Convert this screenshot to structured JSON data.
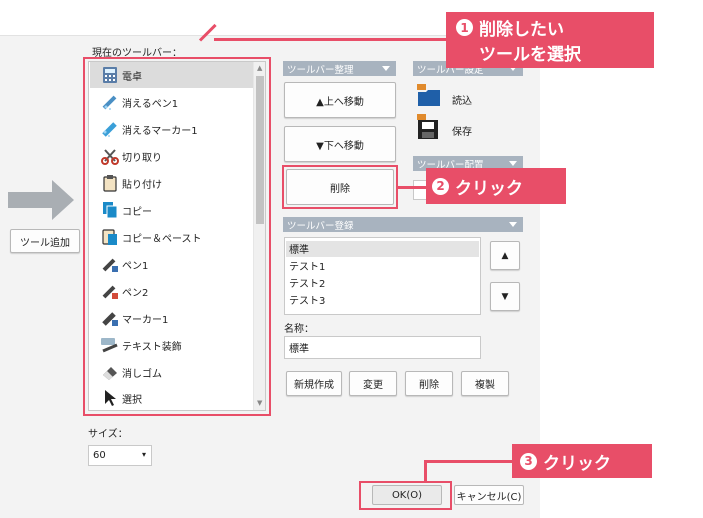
{
  "dialog": {
    "current_toolbar_label": "現在のツールバー：",
    "add_button": "ツール追加",
    "size_label": "サイズ：",
    "size_value": "60",
    "ok_button": "OK(O)",
    "cancel_button": "キャンセル(C)"
  },
  "toolbar_items": [
    {
      "label": "電卓",
      "icon": "calculator-icon",
      "selected": true
    },
    {
      "label": "消えるペン1",
      "icon": "erasing-pen-icon"
    },
    {
      "label": "消えるマーカー1",
      "icon": "erasing-marker-icon"
    },
    {
      "label": "切り取り",
      "icon": "scissors-icon"
    },
    {
      "label": "貼り付け",
      "icon": "clipboard-icon"
    },
    {
      "label": "コピー",
      "icon": "copy-icon"
    },
    {
      "label": "コピー＆ペースト",
      "icon": "copy-paste-icon"
    },
    {
      "label": "ペン1",
      "icon": "pen-icon"
    },
    {
      "label": "ペン2",
      "icon": "pen-icon"
    },
    {
      "label": "マーカー1",
      "icon": "marker-icon"
    },
    {
      "label": "テキスト装飾",
      "icon": "text-decoration-icon"
    },
    {
      "label": "消しゴム",
      "icon": "eraser-icon"
    },
    {
      "label": "選択",
      "icon": "cursor-icon"
    }
  ],
  "arrange": {
    "header": "ツールバー整理",
    "up_button": "▲上へ移動",
    "down_button": "▼下へ移動",
    "delete_button": "削除"
  },
  "settings": {
    "header": "ツールバー設定",
    "load_label": "読込",
    "save_label": "保存",
    "layout_header": "ツールバー配置"
  },
  "register": {
    "header": "ツールバー登録",
    "items": [
      "標準",
      "テスト1",
      "テスト2",
      "テスト3"
    ],
    "up_arrow": "▲",
    "down_arrow": "▼",
    "name_label": "名称：",
    "name_value": "標準",
    "new_button": "新規作成",
    "change_button": "変更",
    "delete_button": "削除",
    "duplicate_button": "複製"
  },
  "annotations": {
    "step1_number": "1",
    "step1_line1": "削除したい",
    "step1_line2": "ツールを選択",
    "step2_number": "2",
    "step2_text": "クリック",
    "step3_number": "3",
    "step3_text": "クリック",
    "accent_color": "#e84e68"
  }
}
